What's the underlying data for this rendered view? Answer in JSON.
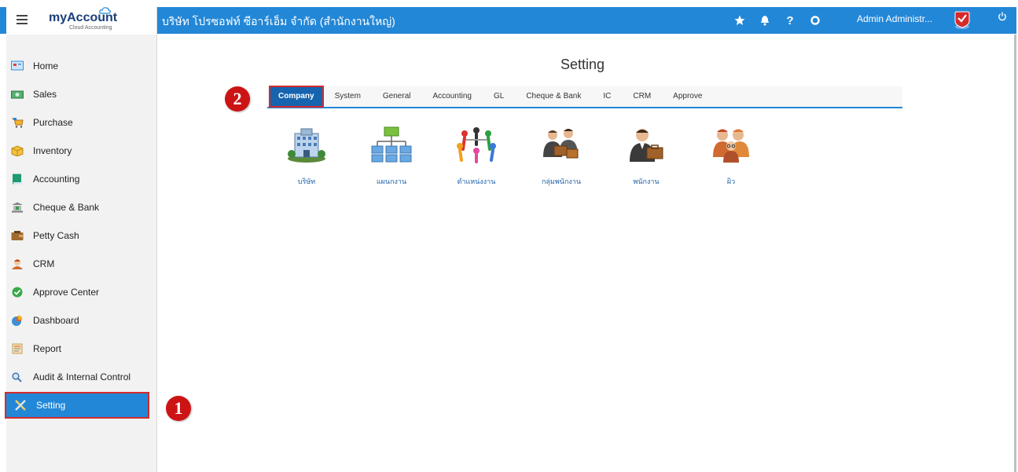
{
  "app": {
    "logo_text": "myAccount",
    "logo_sub": "Cloud Accounting",
    "company_title": "บริษัท โปรซอฟท์ ซีอาร์เอ็ม จำกัด (สำนักงานใหญ่)",
    "admin_name": "Admin Administr...",
    "help_glyph": "?"
  },
  "sidebar": {
    "items": [
      {
        "label": "Home",
        "icon": "home-icon",
        "color": "#3a8fd8"
      },
      {
        "label": "Sales",
        "icon": "sales-icon",
        "color": "#3a9a5a"
      },
      {
        "label": "Purchase",
        "icon": "cart-icon",
        "color": "#e8a020"
      },
      {
        "label": "Inventory",
        "icon": "box-icon",
        "color": "#f0b020"
      },
      {
        "label": "Accounting",
        "icon": "ledger-icon",
        "color": "#1e9a70"
      },
      {
        "label": "Cheque & Bank",
        "icon": "bank-icon",
        "color": "#7a7a7a"
      },
      {
        "label": "Petty Cash",
        "icon": "wallet-icon",
        "color": "#8a5a2a"
      },
      {
        "label": "CRM",
        "icon": "crm-icon",
        "color": "#d06a30"
      },
      {
        "label": "Approve Center",
        "icon": "check-circle-icon",
        "color": "#38a848"
      },
      {
        "label": "Dashboard",
        "icon": "pie-chart-icon",
        "color": "#e06020"
      },
      {
        "label": "Report",
        "icon": "report-icon",
        "color": "#d0a040"
      },
      {
        "label": "Audit & Internal Control",
        "icon": "magnifier-icon",
        "color": "#4a7ab8"
      },
      {
        "label": "Setting",
        "icon": "tools-icon",
        "color": "#e8c040"
      }
    ],
    "active_index": 12
  },
  "callouts": {
    "one": "1",
    "two": "2"
  },
  "main": {
    "title": "Setting",
    "tabs": [
      "Company",
      "System",
      "General",
      "Accounting",
      "GL",
      "Cheque & Bank",
      "IC",
      "CRM",
      "Approve"
    ],
    "active_tab": 0,
    "icons": [
      {
        "label": "บริษัท",
        "icon": "building-icon"
      },
      {
        "label": "แผนกงาน",
        "icon": "org-chart-icon"
      },
      {
        "label": "ตำแหน่งงาน",
        "icon": "people-circle-icon"
      },
      {
        "label": "กลุ่มพนักงาน",
        "icon": "employee-group-icon"
      },
      {
        "label": "พนักงาน",
        "icon": "employee-icon"
      },
      {
        "label": "ผิว",
        "icon": "team-icon"
      }
    ]
  },
  "colors": {
    "accent": "#2387d7",
    "highlight": "#d42a2a",
    "tab_active": "#1664b0"
  }
}
